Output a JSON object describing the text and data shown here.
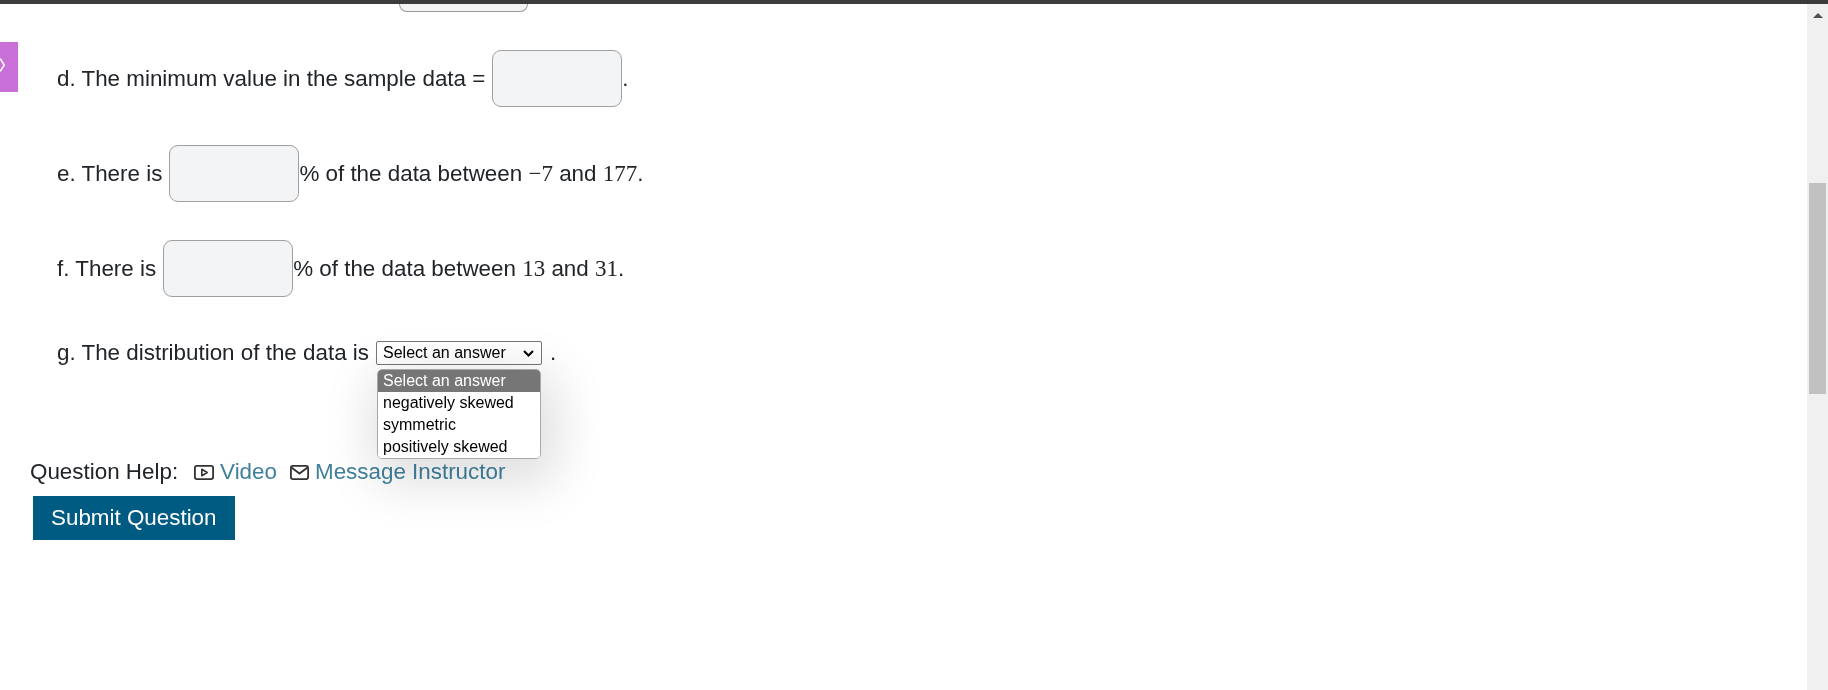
{
  "questions": [
    {
      "kind": "input",
      "label": "d. The minimum value in the sample data =",
      "suffix": [
        {
          "kind": "text",
          "text": "."
        }
      ]
    },
    {
      "kind": "input",
      "label": "e. There is",
      "suffix": [
        {
          "kind": "text",
          "text": "% of the data between "
        },
        {
          "kind": "math",
          "text": "−7"
        },
        {
          "kind": "text",
          "text": " and "
        },
        {
          "kind": "math",
          "text": "177"
        },
        {
          "kind": "text",
          "text": "."
        }
      ]
    },
    {
      "kind": "input",
      "label": "f. There is",
      "suffix": [
        {
          "kind": "text",
          "text": "% of the data between "
        },
        {
          "kind": "math",
          "text": "13"
        },
        {
          "kind": "text",
          "text": " and "
        },
        {
          "kind": "math",
          "text": "31"
        },
        {
          "kind": "text",
          "text": "."
        }
      ]
    },
    {
      "kind": "select",
      "label": "g. The distribution of the data is",
      "select": {
        "value": "Select an answer",
        "expanded": true,
        "options": [
          {
            "label": "Select an answer",
            "selected": true
          },
          {
            "label": "negatively skewed",
            "selected": false
          },
          {
            "label": "symmetric",
            "selected": false
          },
          {
            "label": "positively skewed",
            "selected": false
          }
        ]
      },
      "suffix": [
        {
          "kind": "text",
          "text": "."
        }
      ]
    }
  ],
  "question_help": {
    "label": "Question Help:",
    "links": [
      {
        "kind": "video",
        "text": "Video"
      },
      {
        "kind": "message",
        "text": "Message Instructor"
      }
    ]
  },
  "submit_button": "Submit Question"
}
